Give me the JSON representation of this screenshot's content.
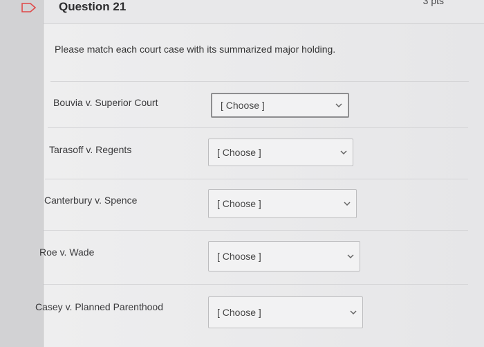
{
  "question": {
    "title": "Question 21",
    "points": "3 pts",
    "prompt": "Please match each court case with its summarized major holding."
  },
  "rows": [
    {
      "case": "Bouvia v. Superior Court",
      "select_value": "[ Choose ]"
    },
    {
      "case": "Tarasoff v. Regents",
      "select_value": "[ Choose ]"
    },
    {
      "case": "Canterbury v. Spence",
      "select_value": "[ Choose ]"
    },
    {
      "case": "Roe v. Wade",
      "select_value": "[ Choose ]"
    },
    {
      "case": "Casey v. Planned Parenthood",
      "select_value": "[ Choose ]"
    }
  ],
  "icons": {
    "flag": "flag-icon",
    "dropdown": "chevron-down-icon"
  },
  "colors": {
    "flag_outline": "#e04848"
  }
}
